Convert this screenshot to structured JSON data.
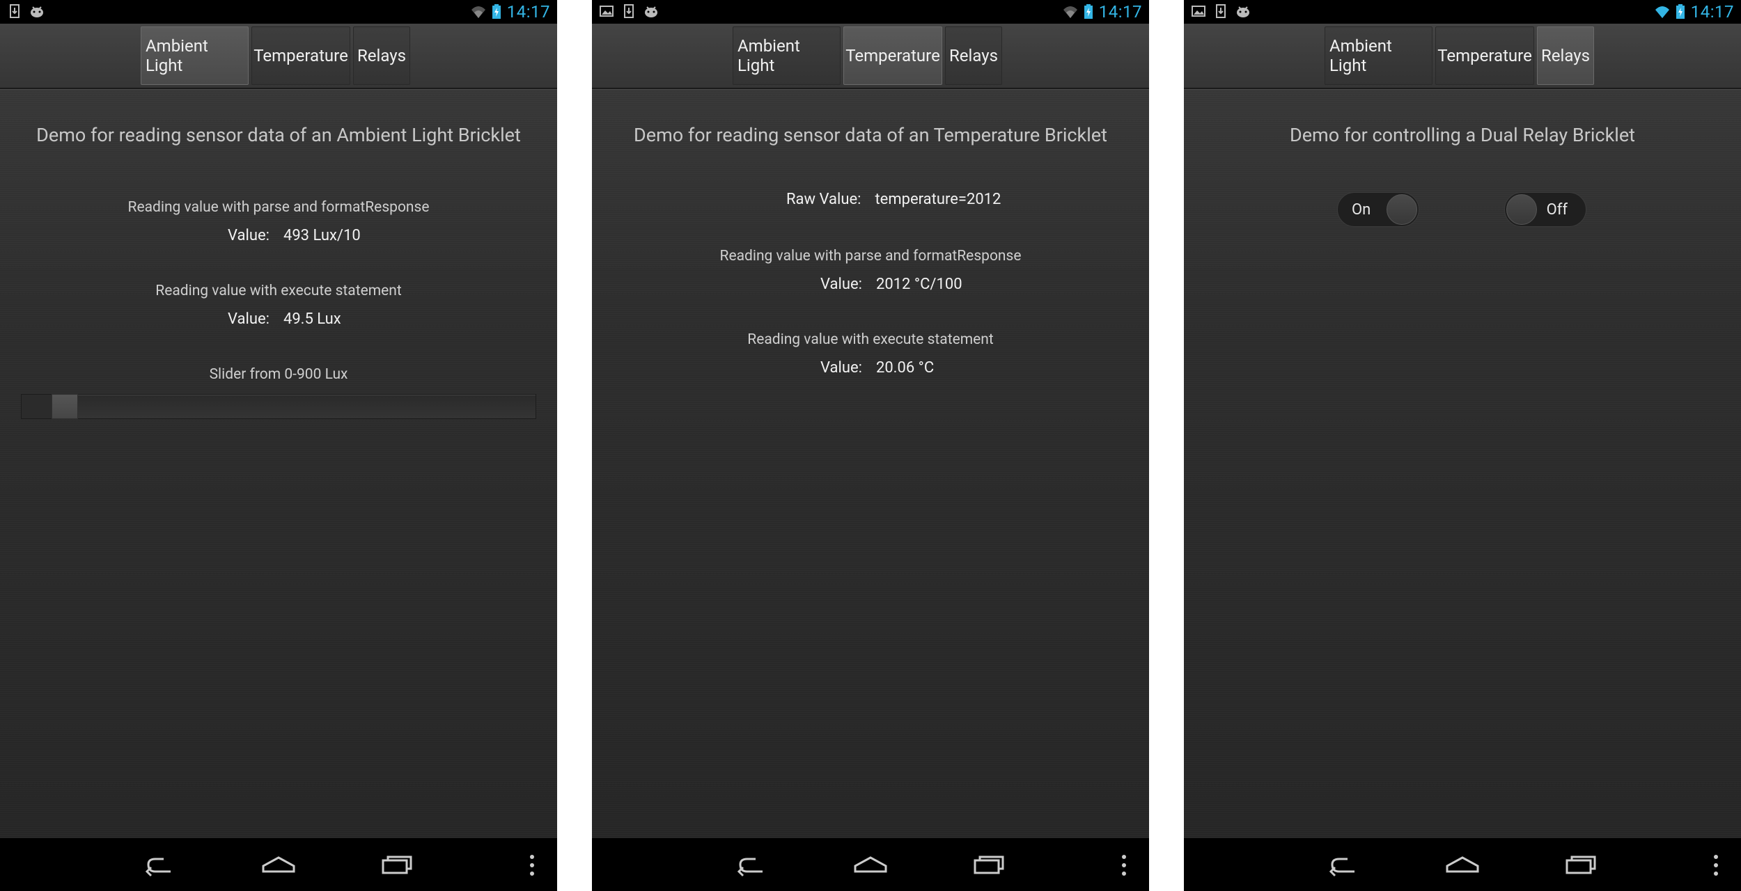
{
  "status_bar": {
    "time": "14:17"
  },
  "tabs": [
    "Ambient Light",
    "Temperature",
    "Relays"
  ],
  "ambient_light": {
    "heading": "Demo for reading sensor data of an Ambient Light Bricklet",
    "parse_label": "Reading value with parse and formatResponse",
    "parse_value_label": "Value:",
    "parse_value": "493 Lux/10",
    "execute_label": "Reading value with execute statement",
    "execute_value_label": "Value:",
    "execute_value": "49.5 Lux",
    "slider_label": "Slider from 0-900 Lux",
    "slider_fraction": 0.055
  },
  "temperature": {
    "heading": "Demo for reading sensor data of an Temperature Bricklet",
    "raw_label": "Raw Value:",
    "raw_value": "temperature=2012",
    "parse_label": "Reading value with parse and formatResponse",
    "parse_value_label": "Value:",
    "parse_value": "2012 °C/100",
    "execute_label": "Reading value with execute statement",
    "execute_value_label": "Value:",
    "execute_value": "20.06 °C"
  },
  "relays": {
    "heading": "Demo for controlling a Dual Relay Bricklet",
    "relay1_label": "On",
    "relay2_label": "Off"
  },
  "icons": {
    "status_left": [
      "download-icon",
      "android-icon",
      "image-icon"
    ],
    "status_right": [
      "wifi-icon",
      "battery-charging-icon"
    ],
    "nav": [
      "back-icon",
      "home-icon",
      "recent-apps-icon",
      "overflow-menu-icon"
    ]
  },
  "colors": {
    "clock": "#33b5e5",
    "background": "#262626"
  }
}
